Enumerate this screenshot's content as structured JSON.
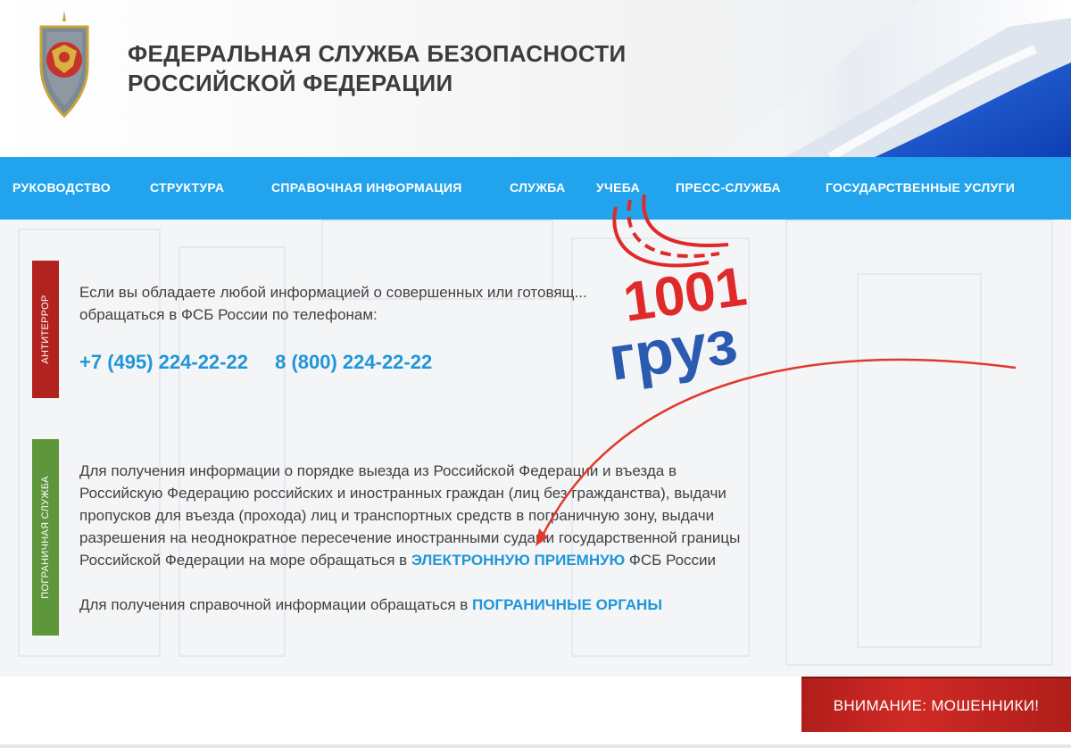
{
  "header": {
    "title_line1": "ФЕДЕРАЛЬНАЯ СЛУЖБА БЕЗОПАСНОСТИ",
    "title_line2": "РОССИЙСКОЙ ФЕДЕРАЦИИ"
  },
  "nav": {
    "items": [
      "РУКОВОДСТВО",
      "СТРУКТУРА",
      "СПРАВОЧНАЯ ИНФОРМАЦИЯ",
      "СЛУЖБА",
      "УЧЕБА",
      "ПРЕСС-СЛУЖБА",
      "ГОСУДАРСТВЕННЫЕ УСЛУГИ"
    ]
  },
  "antiterror": {
    "tab_label": "АНТИТЕРРОР",
    "text_line1": "Если вы обладаете любой информацией о совершенных или готовящ...",
    "text_line2": "обращаться в ФСБ России по телефонам:",
    "phone1": "+7 (495) 224-22-22",
    "phone2": "8 (800) 224-22-22"
  },
  "border_service": {
    "tab_label": "ПОГРАНИЧНАЯ СЛУЖБА",
    "line1": "Для получения информации о порядке выезда из Российской Федерации и въезда в",
    "line2": "Российскую Федерацию российских и иностранных граждан (лиц без гражданства), выдачи",
    "line3": "пропусков для въезда (прохода) лиц и транспортных средств в пограничную зону, выдачи",
    "line4": "разрешения на неоднократное пересечение иностранными судами государственной границы",
    "line5_prefix": "Российской Федерации на море обращаться в ",
    "line5_link": "ЭЛЕКТРОННУЮ ПРИЕМНУЮ",
    "line5_suffix": " ФСБ России",
    "info_prefix": "Для получения справочной информации обращаться в ",
    "info_link": "ПОГРАНИЧНЫЕ ОРГАНЫ"
  },
  "overlay_logo": {
    "top": "1001",
    "bottom": "груз"
  },
  "warning_button": "ВНИМАНИЕ: МОШЕННИКИ!",
  "colors": {
    "nav_blue": "#22a3ee",
    "link_blue": "#1f96d9",
    "tab_red": "#b2231f",
    "tab_green": "#5e963b",
    "warn_red": "#c0231f",
    "logo_red": "#e02a2a",
    "logo_blue": "#2a5bb0"
  },
  "icons": [
    "fsb-emblem-icon",
    "russian-flag-banner",
    "1001-gruz-logo",
    "red-arrow"
  ]
}
